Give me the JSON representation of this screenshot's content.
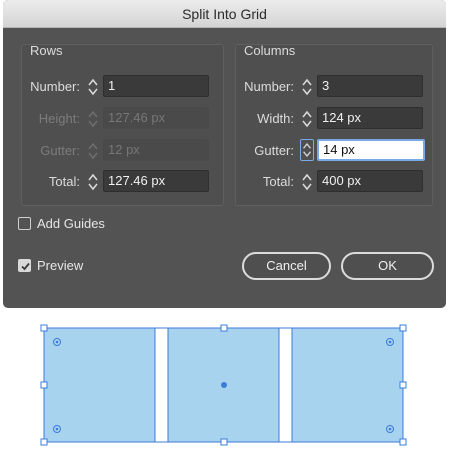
{
  "dialog": {
    "title": "Split Into Grid",
    "rows": {
      "title": "Rows",
      "number": {
        "label": "Number:",
        "value": "1"
      },
      "height": {
        "label": "Height:",
        "value": "127.46 px"
      },
      "gutter": {
        "label": "Gutter:",
        "value": "12 px"
      },
      "total": {
        "label": "Total:",
        "value": "127.46 px"
      }
    },
    "columns": {
      "title": "Columns",
      "number": {
        "label": "Number:",
        "value": "3"
      },
      "width": {
        "label": "Width:",
        "value": "124 px"
      },
      "gutter": {
        "label": "Gutter:",
        "value": "14 px"
      },
      "total": {
        "label": "Total:",
        "value": "400 px"
      }
    },
    "add_guides": {
      "label": "Add Guides",
      "checked": false
    },
    "preview": {
      "label": "Preview",
      "checked": true
    },
    "cancel_label": "Cancel",
    "ok_label": "OK"
  },
  "colors": {
    "dialog_bg": "#535353",
    "cell_fill": "#a8d3ef",
    "selection": "#3b7bd8"
  },
  "canvas": {
    "columns": 3,
    "rows": 1
  }
}
